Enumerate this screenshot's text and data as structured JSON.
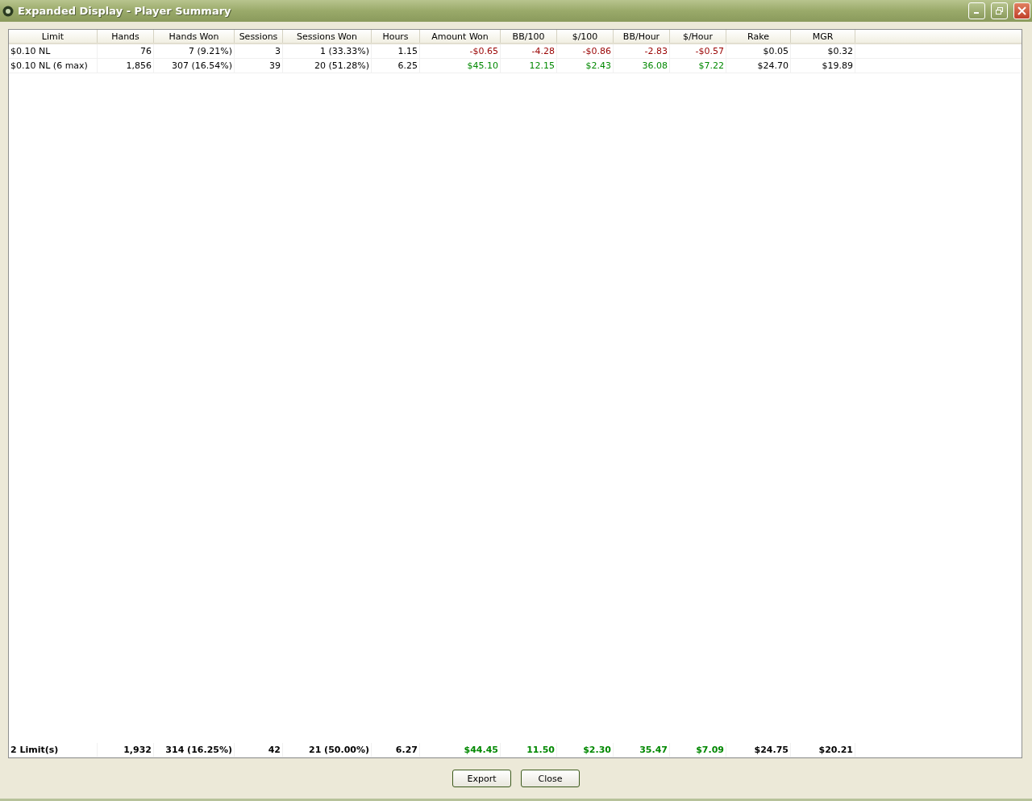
{
  "window": {
    "title": "Expanded Display - Player Summary"
  },
  "table": {
    "columns": [
      "Limit",
      "Hands",
      "Hands Won",
      "Sessions",
      "Sessions Won",
      "Hours",
      "Amount Won",
      "BB/100",
      "$/100",
      "BB/Hour",
      "$/Hour",
      "Rake",
      "MGR"
    ],
    "rows": [
      [
        {
          "text": "$0.10 NL"
        },
        {
          "text": "76"
        },
        {
          "text": "7 (9.21%)"
        },
        {
          "text": "3"
        },
        {
          "text": "1 (33.33%)"
        },
        {
          "text": "1.15"
        },
        {
          "text": "-$0.65",
          "color": "#990000"
        },
        {
          "text": "-4.28",
          "color": "#990000"
        },
        {
          "text": "-$0.86",
          "color": "#990000"
        },
        {
          "text": "-2.83",
          "color": "#990000"
        },
        {
          "text": "-$0.57",
          "color": "#990000"
        },
        {
          "text": "$0.05"
        },
        {
          "text": "$0.32"
        }
      ],
      [
        {
          "text": "$0.10 NL (6 max)"
        },
        {
          "text": "1,856"
        },
        {
          "text": "307 (16.54%)"
        },
        {
          "text": "39"
        },
        {
          "text": "20 (51.28%)"
        },
        {
          "text": "6.25"
        },
        {
          "text": "$45.10",
          "color": "#008800"
        },
        {
          "text": "12.15",
          "color": "#008800"
        },
        {
          "text": "$2.43",
          "color": "#008800"
        },
        {
          "text": "36.08",
          "color": "#008800"
        },
        {
          "text": "$7.22",
          "color": "#008800"
        },
        {
          "text": "$24.70"
        },
        {
          "text": "$19.89"
        }
      ]
    ],
    "total": [
      {
        "text": "2 Limit(s)"
      },
      {
        "text": "1,932"
      },
      {
        "text": "314 (16.25%)"
      },
      {
        "text": "42"
      },
      {
        "text": "21 (50.00%)"
      },
      {
        "text": "6.27"
      },
      {
        "text": "$44.45",
        "color": "#008800"
      },
      {
        "text": "11.50",
        "color": "#008800"
      },
      {
        "text": "$2.30",
        "color": "#008800"
      },
      {
        "text": "35.47",
        "color": "#008800"
      },
      {
        "text": "$7.09",
        "color": "#008800"
      },
      {
        "text": "$24.75"
      },
      {
        "text": "$20.21"
      }
    ]
  },
  "buttons": [
    "Export",
    "Close"
  ]
}
